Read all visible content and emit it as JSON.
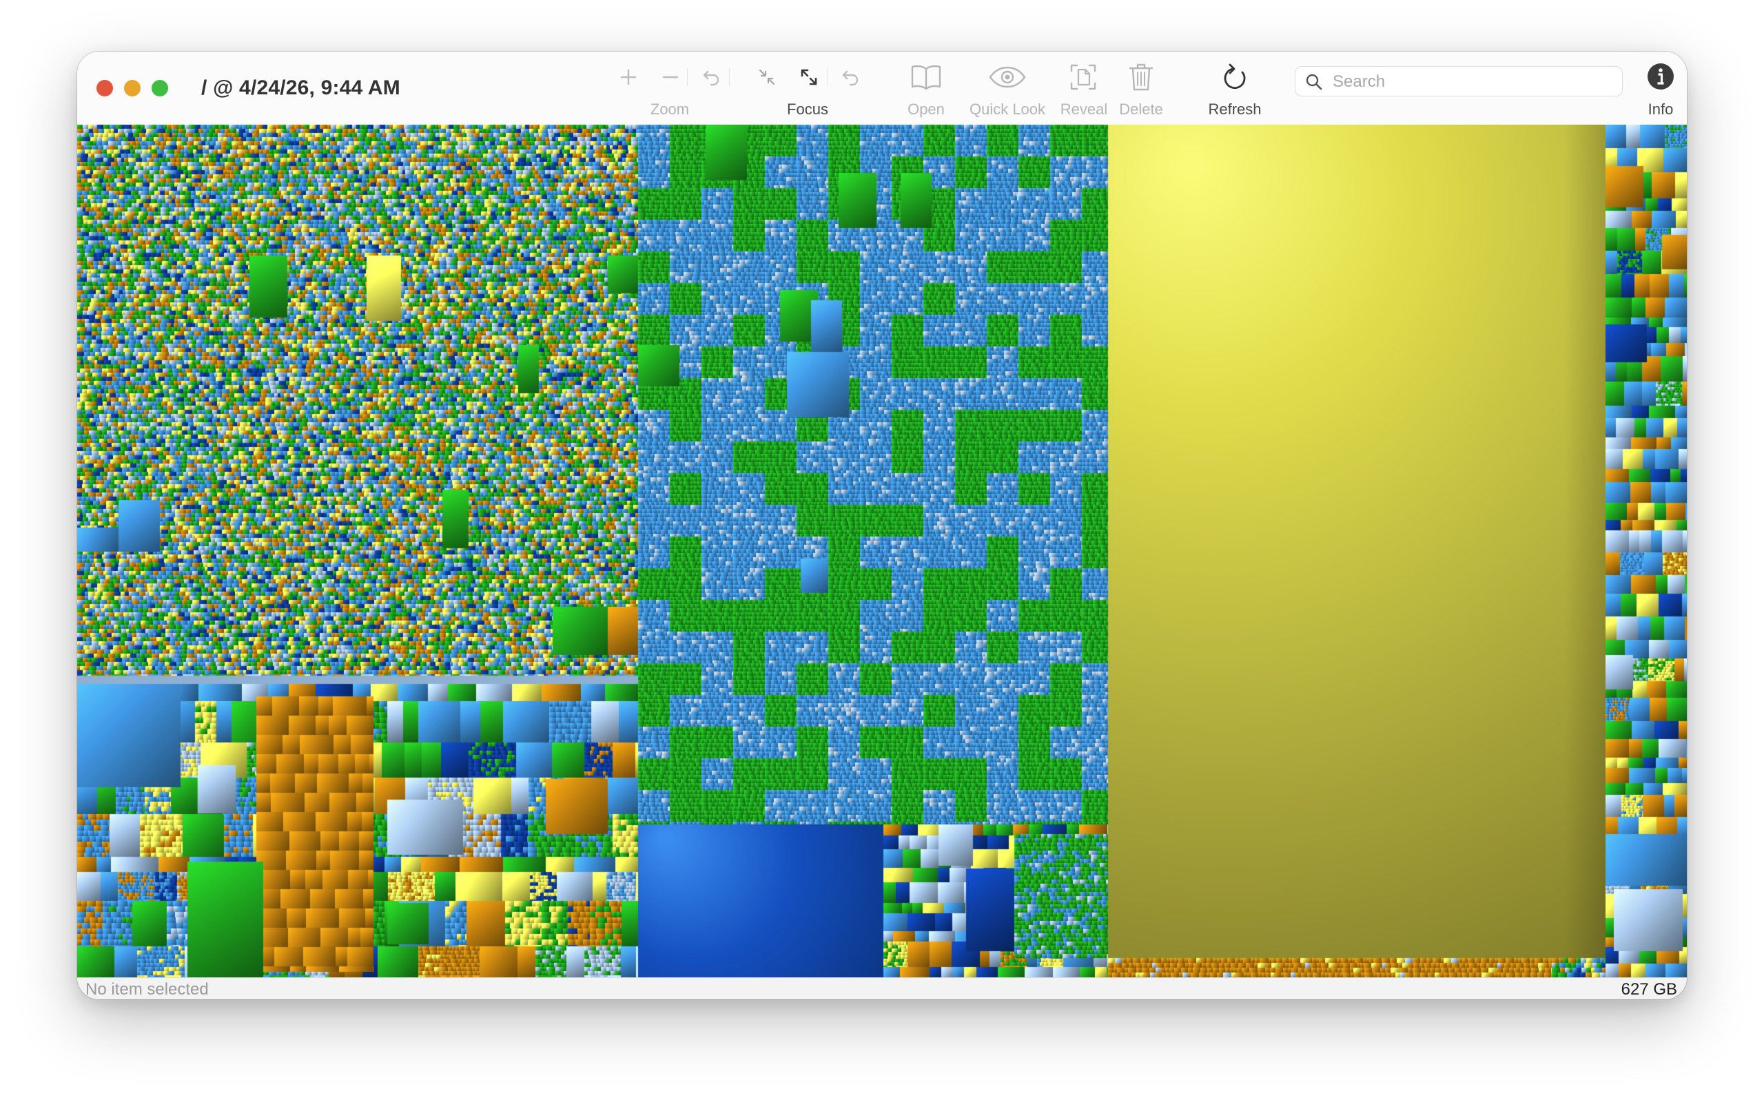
{
  "window": {
    "title": "/ @ 4/24/26, 9:44 AM",
    "traffic_lights": {
      "close": "#e0553c",
      "minimize": "#e9a52a",
      "zoom": "#3fbd40"
    }
  },
  "toolbar": {
    "zoom_group": {
      "label": "Zoom",
      "buttons": [
        "zoom-in-icon",
        "zoom-out-icon",
        "undo-zoom-icon"
      ],
      "enabled": false
    },
    "focus_group": {
      "label": "Focus",
      "buttons": [
        "focus-in-icon",
        "focus-out-icon",
        "undo-focus-icon"
      ]
    },
    "open": {
      "label": "Open",
      "icon": "book-icon",
      "enabled": false
    },
    "quick_look": {
      "label": "Quick Look",
      "icon": "eye-icon",
      "enabled": false
    },
    "reveal": {
      "label": "Reveal",
      "icon": "reveal-icon",
      "enabled": false
    },
    "delete": {
      "label": "Delete",
      "icon": "trash-icon",
      "enabled": false
    },
    "refresh": {
      "label": "Refresh",
      "icon": "refresh-icon",
      "enabled": true
    },
    "search": {
      "placeholder": "Search",
      "value": ""
    },
    "info": {
      "label": "Info",
      "icon": "info-icon"
    }
  },
  "treemap": {
    "colors": {
      "blue": "#3f93dd",
      "green": "#1fa81f",
      "orange": "#c7840f",
      "yellow": "#f6f35a",
      "olive": "#7c7a26",
      "navy": "#0e3da0",
      "light_blue": "#a9c8ea"
    },
    "regions": [
      {
        "name": "region-mixed-files-top-left",
        "pattern": "mixed-fine"
      },
      {
        "name": "region-mixed-files-bottom-left",
        "pattern": "mixed-coarse"
      },
      {
        "name": "region-blue-green-block",
        "pattern": "blue-green"
      },
      {
        "name": "region-large-blue-file",
        "pattern": "single"
      },
      {
        "name": "region-mixed-files-bottom-center",
        "pattern": "mixed-coarse"
      },
      {
        "name": "region-large-yellow-file",
        "pattern": "single"
      },
      {
        "name": "region-orange-strip",
        "pattern": "orange-fine"
      },
      {
        "name": "region-mixed-files-right-column",
        "pattern": "mixed-coarse"
      }
    ]
  },
  "status": {
    "selection_text": "No item selected",
    "total_size": "627 GB"
  }
}
